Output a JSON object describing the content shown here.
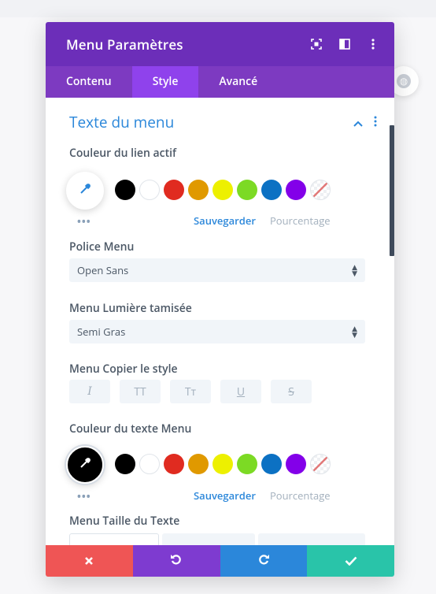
{
  "modal": {
    "title": "Menu Paramètres",
    "header_icons": [
      "focus-icon",
      "columns-icon",
      "more-vertical-icon"
    ]
  },
  "tabs": [
    {
      "label": "Contenu",
      "active": false
    },
    {
      "label": "Style",
      "active": true
    },
    {
      "label": "Avancé",
      "active": false
    }
  ],
  "section": {
    "title": "Texte du menu"
  },
  "active_link_color": {
    "label": "Couleur du lien actif",
    "save_label": "Sauvegarder",
    "percent_label": "Pourcentage",
    "current": "#ffffff"
  },
  "font": {
    "label": "Police Menu",
    "value": "Open Sans"
  },
  "weight": {
    "label": "Menu Lumière tamisée",
    "value": "Semi Gras"
  },
  "text_style": {
    "label": "Menu Copier le style",
    "buttons": [
      "I",
      "TT",
      "Tт",
      "U",
      "S"
    ]
  },
  "text_color": {
    "label": "Couleur du texte Menu",
    "save_label": "Sauvegarder",
    "percent_label": "Pourcentage",
    "current": "#000000"
  },
  "text_size": {
    "label": "Menu Taille du Texte"
  },
  "palette": [
    "#000000",
    "#ffffff",
    "#e02b20",
    "#e09900",
    "#edf000",
    "#7cda24",
    "#0c71c3",
    "#8300e9"
  ],
  "footer_colors": {
    "cancel": "#ef5555",
    "undo": "#7e3bd0",
    "redo": "#2b87da",
    "save": "#29c4a9"
  },
  "theme": {
    "header": "#6c2eb9",
    "tabs": "#7d3ac1",
    "active_tab": "#8f42ec",
    "accent": "#2b87da"
  }
}
